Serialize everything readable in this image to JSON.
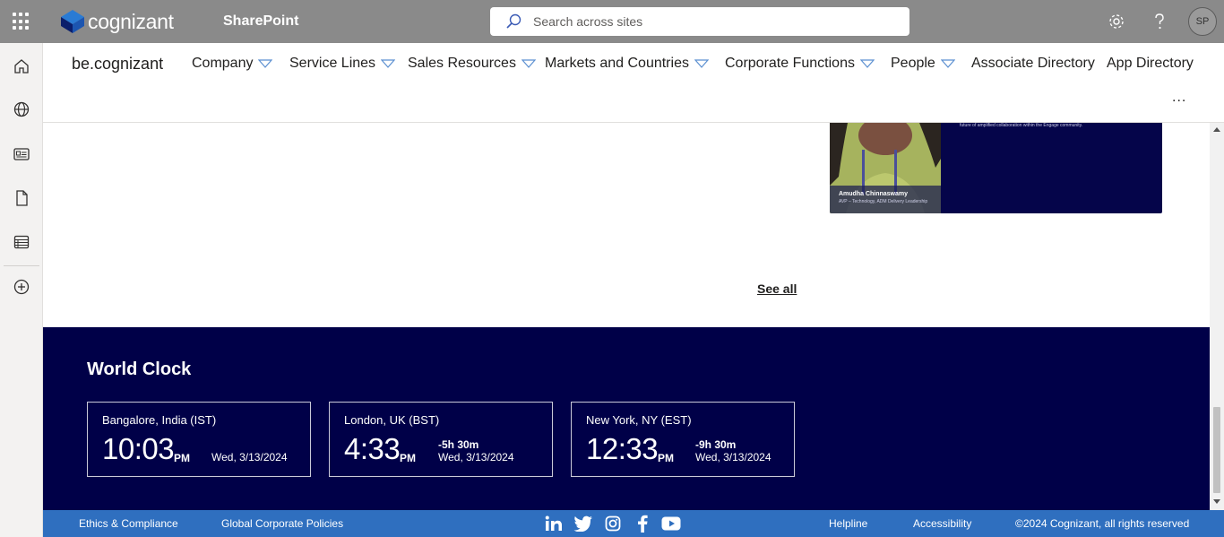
{
  "suitebar": {
    "logo_text": "cognizant",
    "app_name": "SharePoint",
    "search_placeholder": "Search across sites",
    "avatar_initials": "SP"
  },
  "hubnav": {
    "site_title": "be.cognizant",
    "items": [
      {
        "label": "Company"
      },
      {
        "label": "Service Lines"
      },
      {
        "label": "Sales Resources"
      },
      {
        "label": "Markets and Countries"
      },
      {
        "label": "Corporate Functions"
      },
      {
        "label": "People"
      },
      {
        "label": "Associate Directory"
      },
      {
        "label": "App Directory"
      }
    ],
    "more": "..."
  },
  "news_card": {
    "person_name": "Amudha Chinnaswamy",
    "person_role": "AVP – Technology, ADM Delivery Leadership",
    "text": "future of amplified collaboration within the Engage community."
  },
  "see_all": "See all",
  "world_clock": {
    "title": "World Clock",
    "clocks": [
      {
        "city": "Bangalore, India (IST)",
        "time": "10:03",
        "ampm": "PM",
        "offset": "",
        "date": "Wed, 3/13/2024"
      },
      {
        "city": "London, UK (BST)",
        "time": "4:33",
        "ampm": "PM",
        "offset": "-5h 30m",
        "date": "Wed, 3/13/2024"
      },
      {
        "city": "New York, NY (EST)",
        "time": "12:33",
        "ampm": "PM",
        "offset": "-9h 30m",
        "date": "Wed, 3/13/2024"
      }
    ]
  },
  "footer": {
    "ethics": "Ethics & Compliance",
    "policies": "Global Corporate Policies",
    "helpline": "Helpline",
    "accessibility": "Accessibility",
    "copyright": "©2024 Cognizant, all rights reserved",
    "social_icons": [
      "linkedin-icon",
      "twitter-icon",
      "instagram-icon",
      "facebook-icon",
      "youtube-icon"
    ]
  },
  "colors": {
    "suitebar": "#8a8a8a",
    "world_clock_bg": "#000048",
    "footer_bg": "#2f6fbf"
  }
}
